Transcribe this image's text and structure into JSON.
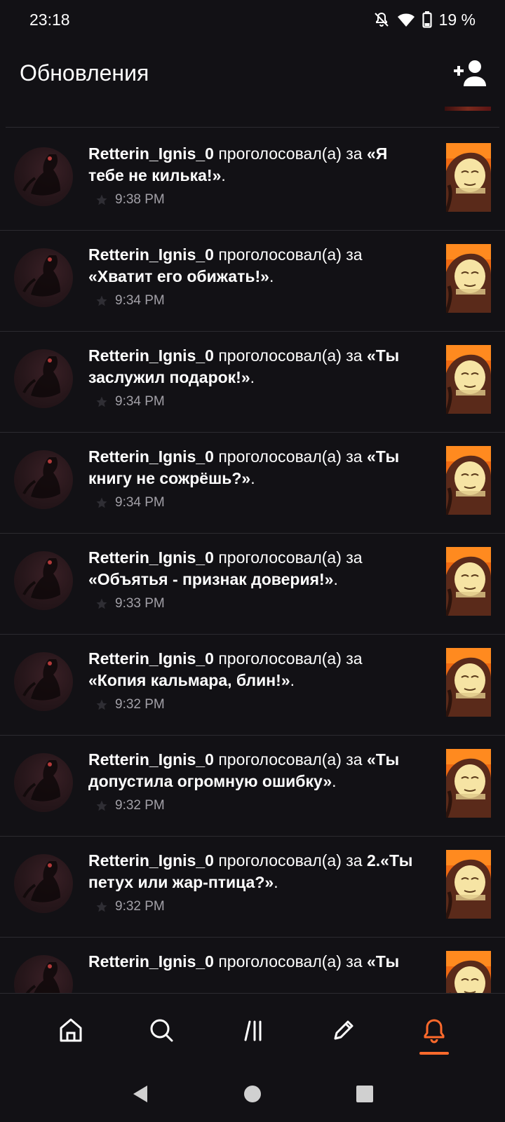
{
  "status_bar": {
    "time": "23:18",
    "battery": "19 %"
  },
  "header": {
    "title": "Обновления",
    "icons": [
      "add-person-icon"
    ]
  },
  "feed": {
    "items": [
      {
        "user": "Retterin_Ignis_0",
        "action": "проголосовал(а) за",
        "title": "«Я тебе не килька!»",
        "end": ".",
        "time": "9:38 PM"
      },
      {
        "user": "Retterin_Ignis_0",
        "action": "проголосовал(а) за",
        "title": "«Хватит его обижать!»",
        "end": ".",
        "time": "9:34 PM"
      },
      {
        "user": "Retterin_Ignis_0",
        "action": "проголосовал(а) за",
        "title": "«Ты заслужил подарок!»",
        "end": ".",
        "time": "9:34 PM"
      },
      {
        "user": "Retterin_Ignis_0",
        "action": "проголосовал(а) за",
        "title": "«Ты книгу не сожрёшь?»",
        "end": ".",
        "time": "9:34 PM"
      },
      {
        "user": "Retterin_Ignis_0",
        "action": "проголосовал(а) за",
        "title": "«Объятья - признак доверия!»",
        "end": ".",
        "time": "9:33 PM"
      },
      {
        "user": "Retterin_Ignis_0",
        "action": "проголосовал(а) за",
        "title": "«Копия кальмара, блин!»",
        "end": ".",
        "time": "9:32 PM"
      },
      {
        "user": "Retterin_Ignis_0",
        "action": "проголосовал(а) за",
        "title": "«Ты допустила огромную ошибку»",
        "end": ".",
        "time": "9:32 PM"
      },
      {
        "user": "Retterin_Ignis_0",
        "action": "проголосовал(а) за",
        "title": "2.«Ты петух или жар-птица?»",
        "end": ".",
        "time": "9:32 PM"
      },
      {
        "user": "Retterin_Ignis_0",
        "action": "проголосовал(а) за",
        "title": "«Ты",
        "end": "",
        "time": ""
      }
    ]
  },
  "bottom_nav": {
    "items": [
      "home-icon",
      "search-icon",
      "library-icon",
      "write-icon",
      "notifications-icon"
    ],
    "active": "notifications-icon",
    "accent_color": "#ff6a2c"
  },
  "system_nav": {
    "items": [
      "back-icon",
      "home-circle-icon",
      "recents-icon"
    ]
  }
}
